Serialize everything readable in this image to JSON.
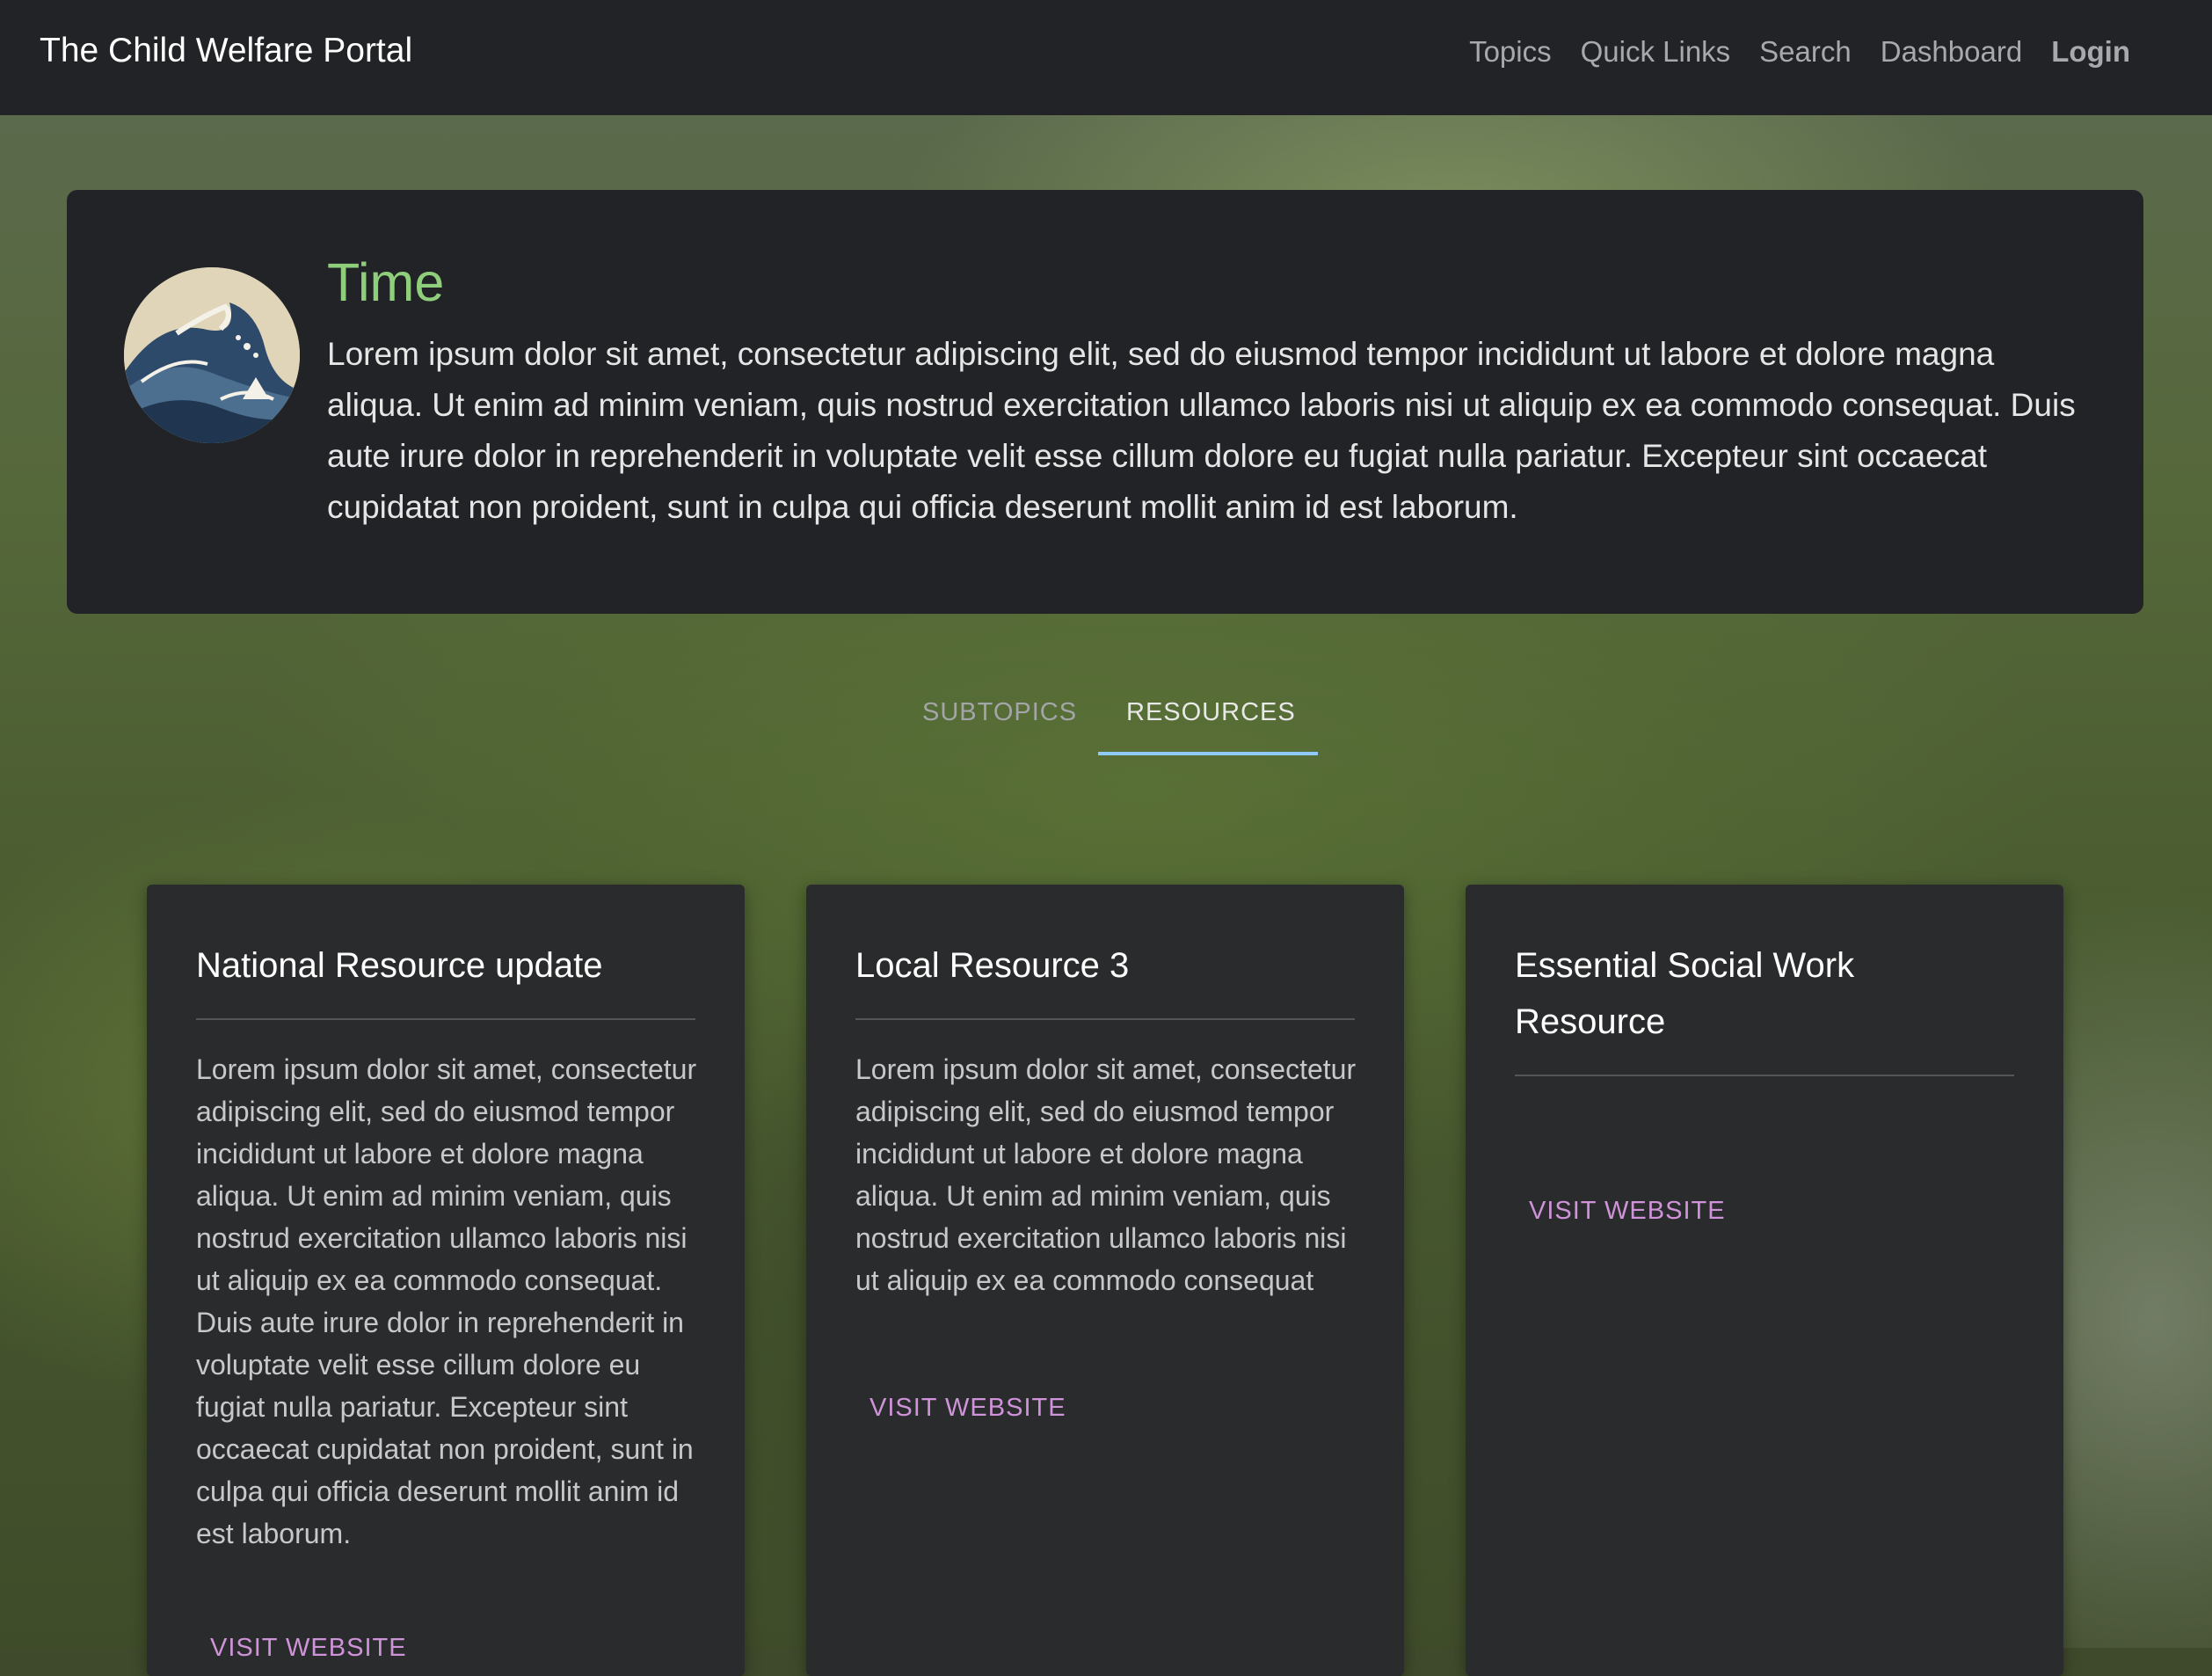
{
  "navbar": {
    "brand": "The Child Welfare Portal",
    "links": [
      "Topics",
      "Quick Links",
      "Search",
      "Dashboard",
      "Login"
    ]
  },
  "topic": {
    "title": "Time",
    "description": "Lorem ipsum dolor sit amet, consectetur adipiscing elit, sed do eiusmod tempor incididunt ut labore et dolore magna aliqua. Ut enim ad minim veniam, quis nostrud exercitation ullamco laboris nisi ut aliquip ex ea commodo consequat. Duis aute irure dolor in reprehenderit in voluptate velit esse cillum dolore eu fugiat nulla pariatur. Excepteur sint occaecat cupidatat non proident, sunt in culpa qui officia deserunt mollit anim id est laborum."
  },
  "tabs": {
    "items": [
      "SUBTOPICS",
      "RESOURCES"
    ],
    "active": "RESOURCES"
  },
  "resources": [
    {
      "title": "National Resource update",
      "description": "Lorem ipsum dolor sit amet, consectetur adipiscing elit, sed do eiusmod tempor incididunt ut labore et dolore magna aliqua. Ut enim ad minim veniam, quis nostrud exercitation ullamco laboris nisi ut aliquip ex ea commodo consequat. Duis aute irure dolor in reprehenderit in voluptate velit esse cillum dolore eu fugiat nulla pariatur. Excepteur sint occaecat cupidatat non proident, sunt in culpa qui officia deserunt mollit anim id est laborum.",
      "button": "VISIT WEBSITE"
    },
    {
      "title": "Local Resource 3",
      "description": "Lorem ipsum dolor sit amet, consectetur adipiscing elit, sed do eiusmod tempor incididunt ut labore et dolore magna aliqua. Ut enim ad minim veniam, quis nostrud exercitation ullamco laboris nisi ut aliquip ex ea commodo consequat",
      "button": "VISIT WEBSITE"
    },
    {
      "title": "Essential Social Work Resource",
      "description": "",
      "button": "VISIT WEBSITE"
    }
  ],
  "colors": {
    "navbar_bg": "#212326",
    "topic_title": "#8fcf7c",
    "tab_indicator": "#90caf9",
    "link_button": "#ce93d8",
    "card_bg": "#2a2b2c"
  },
  "icons": {
    "avatar": "great-wave-image-icon"
  }
}
